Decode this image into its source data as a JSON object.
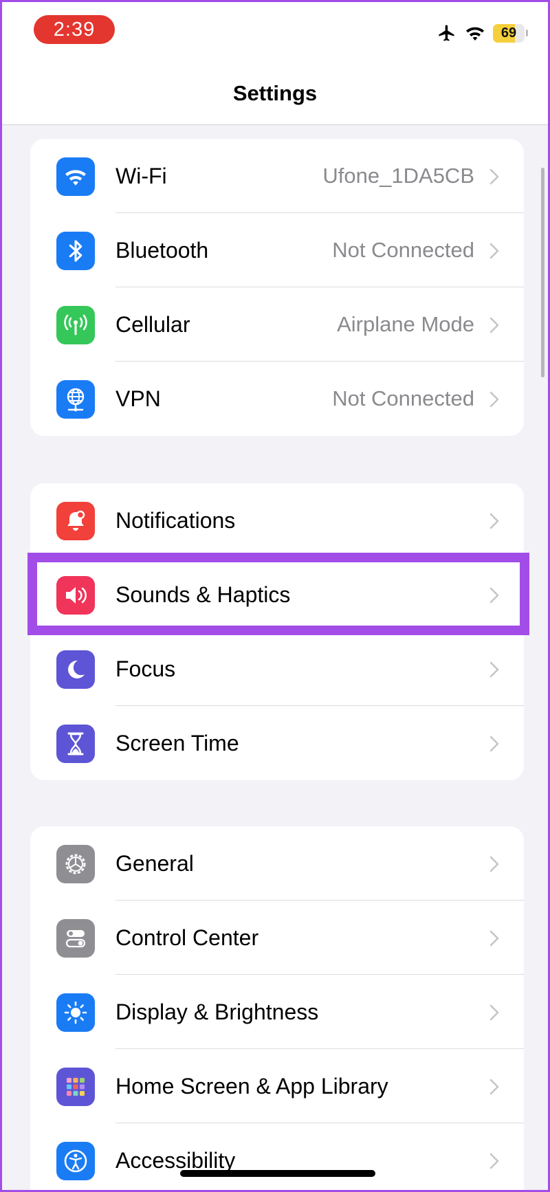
{
  "status_bar": {
    "time": "2:39",
    "battery_level": 69
  },
  "header": {
    "title": "Settings"
  },
  "groups": [
    {
      "name": "connectivity",
      "items": [
        {
          "label": "Wi-Fi",
          "value": "Ufone_1DA5CB",
          "icon": "wifi-icon",
          "color": "#1a7cf5"
        },
        {
          "label": "Bluetooth",
          "value": "Not Connected",
          "icon": "bluetooth-icon",
          "color": "#1a7cf5"
        },
        {
          "label": "Cellular",
          "value": "Airplane Mode",
          "icon": "cellular-antenna-icon",
          "color": "#35c759"
        },
        {
          "label": "VPN",
          "value": "Not Connected",
          "icon": "globe-network-icon",
          "color": "#1a7cf5"
        }
      ]
    },
    {
      "name": "attention",
      "items": [
        {
          "label": "Notifications",
          "icon": "bell-badge-icon",
          "color": "#f2403a"
        },
        {
          "label": "Sounds & Haptics",
          "icon": "speaker-icon",
          "color": "#f0345a",
          "highlighted": true
        },
        {
          "label": "Focus",
          "icon": "moon-icon",
          "color": "#5e55d6"
        },
        {
          "label": "Screen Time",
          "icon": "hourglass-icon",
          "color": "#5e55d6"
        }
      ]
    },
    {
      "name": "system",
      "items": [
        {
          "label": "General",
          "icon": "gear-icon",
          "color": "#8e8e93"
        },
        {
          "label": "Control Center",
          "icon": "toggles-icon",
          "color": "#8e8e93"
        },
        {
          "label": "Display & Brightness",
          "icon": "sun-icon",
          "color": "#1a7cf5"
        },
        {
          "label": "Home Screen & App Library",
          "icon": "app-grid-icon",
          "color": "#5e55d6"
        },
        {
          "label": "Accessibility",
          "icon": "accessibility-icon",
          "color": "#1a7cf5"
        }
      ]
    }
  ]
}
